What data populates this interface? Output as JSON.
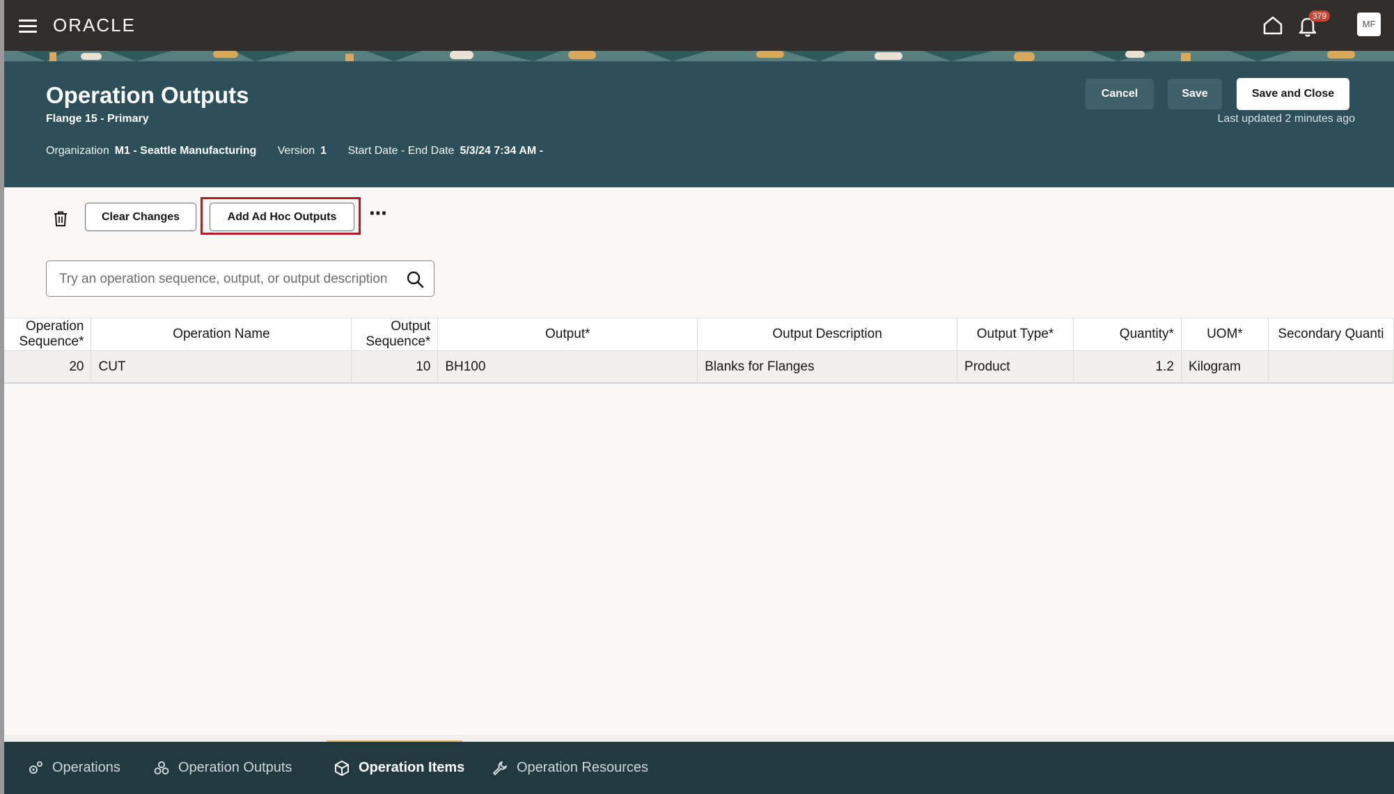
{
  "topbar": {
    "logo": "ORACLE",
    "notification_count": "379",
    "avatar_initials": "MF"
  },
  "header": {
    "title": "Operation Outputs",
    "subtitle": "Flange 15 - Primary",
    "organization_label": "Organization",
    "organization_value": "M1 - Seattle Manufacturing",
    "version_label": "Version",
    "version_value": "1",
    "dates_label": "Start Date - End Date",
    "dates_value": "5/3/24 7:34 AM -",
    "cancel_label": "Cancel",
    "save_label": "Save",
    "save_close_label": "Save and Close",
    "last_updated": "Last updated 2 minutes ago"
  },
  "toolbar": {
    "clear_label": "Clear Changes",
    "adhoc_label": "Add Ad Hoc Outputs",
    "more_label": "⋯"
  },
  "search": {
    "placeholder": "Try an operation sequence, output, or output description"
  },
  "table": {
    "columns": [
      "Operation Sequence*",
      "Operation Name",
      "Output Sequence*",
      "Output*",
      "Output Description",
      "Output Type*",
      "Quantity*",
      "UOM*",
      "Secondary Quanti"
    ],
    "rows": [
      {
        "op_seq": "20",
        "op_name": "CUT",
        "out_seq": "10",
        "output": "BH100",
        "description": "Blanks for Flanges",
        "type": "Product",
        "quantity": "1.2",
        "uom": "Kilogram",
        "secondary": ""
      }
    ]
  },
  "bottom_nav": {
    "tabs": [
      {
        "label": "Operations"
      },
      {
        "label": "Operation Outputs"
      },
      {
        "label": "Operation Items"
      },
      {
        "label": "Operation Resources"
      }
    ],
    "active": "Operation Items"
  },
  "colors": {
    "topbar": "#312d2a",
    "hero": "#2c4f59",
    "bottom_nav": "#21393f",
    "highlight": "#b21b24",
    "badge": "#c74634"
  }
}
